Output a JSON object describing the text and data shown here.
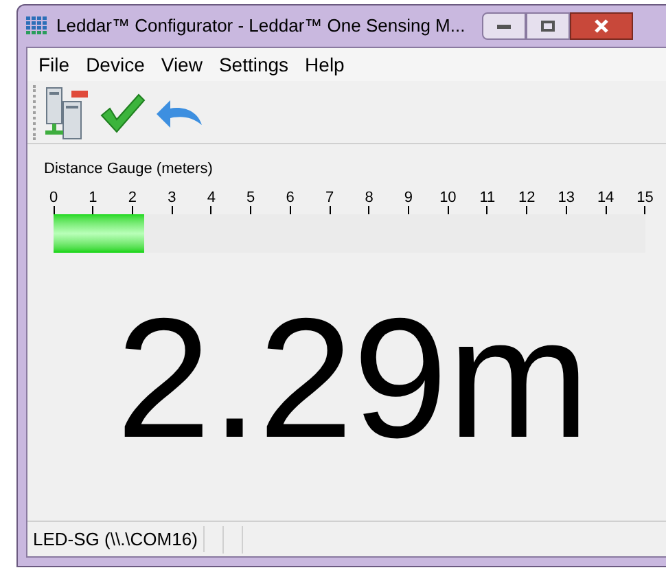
{
  "window": {
    "title": "Leddar™ Configurator - Leddar™ One Sensing M..."
  },
  "menu": [
    "File",
    "Device",
    "View",
    "Settings",
    "Help"
  ],
  "toolbar": [
    {
      "kind": "servers"
    },
    {
      "kind": "check"
    },
    {
      "kind": "undo"
    }
  ],
  "gauge": {
    "title": "Distance Gauge (meters)",
    "ticks": [
      "0",
      "1",
      "2",
      "3",
      "4",
      "5",
      "6",
      "7",
      "8",
      "9",
      "10",
      "11",
      "12",
      "13",
      "14",
      "15"
    ],
    "level": 0.153
  },
  "reading": "2.29m",
  "status_bar": {
    "device": "LED-SG (\\\\.\\COM16)"
  }
}
